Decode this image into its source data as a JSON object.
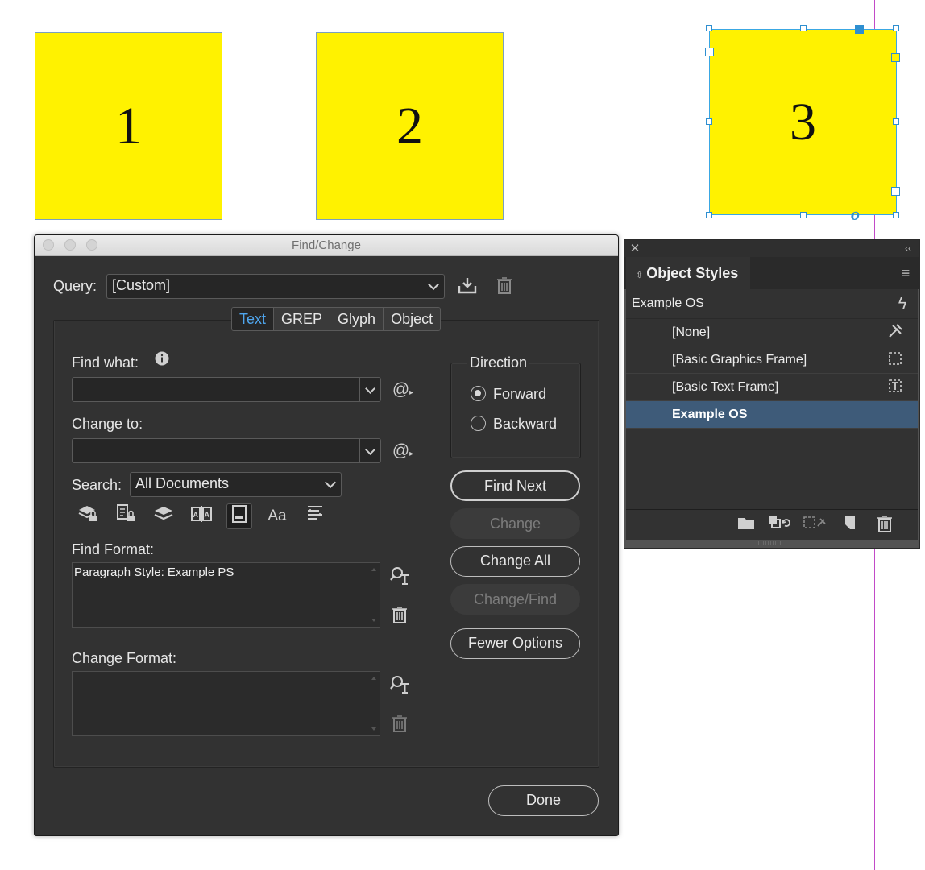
{
  "canvas": {
    "frames": [
      {
        "label": "1"
      },
      {
        "label": "2"
      },
      {
        "label": "3"
      }
    ]
  },
  "dialog": {
    "title": "Find/Change",
    "query_label": "Query:",
    "query_value": "[Custom]",
    "tabs": [
      "Text",
      "GREP",
      "Glyph",
      "Object"
    ],
    "active_tab": "Text",
    "find_what_label": "Find what:",
    "find_what_value": "",
    "change_to_label": "Change to:",
    "change_to_value": "",
    "search_label": "Search:",
    "search_value": "All Documents",
    "find_format_label": "Find Format:",
    "find_format_value": "Paragraph Style: Example PS",
    "change_format_label": "Change Format:",
    "change_format_value": "",
    "direction": {
      "label": "Direction",
      "options": [
        "Forward",
        "Backward"
      ],
      "selected": "Forward"
    },
    "buttons": {
      "find_next": "Find Next",
      "change": "Change",
      "change_all": "Change All",
      "change_find": "Change/Find",
      "fewer_options": "Fewer Options",
      "done": "Done"
    },
    "special_char_glyph": "@",
    "search_option_case_glyph": "Aa"
  },
  "object_styles_panel": {
    "tab_label": "Object Styles",
    "current_style": "Example OS",
    "styles": [
      {
        "name": "[None]",
        "icon": "no-style-icon"
      },
      {
        "name": "[Basic Graphics Frame]",
        "icon": "graphics-frame-icon"
      },
      {
        "name": "[Basic Text Frame]",
        "icon": "text-frame-icon"
      },
      {
        "name": "Example OS",
        "icon": "",
        "selected": true
      }
    ]
  },
  "colors": {
    "frame_fill": "#fff200",
    "dialog_bg": "#323232",
    "active_tab_text": "#4fa6ee",
    "selected_row": "#3e5b79",
    "guide": "#c24ac8"
  }
}
